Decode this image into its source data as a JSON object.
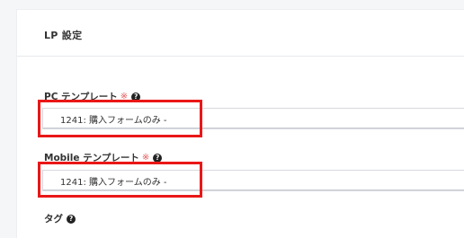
{
  "section": {
    "title": "LP 設定"
  },
  "fields": {
    "pc_template": {
      "label": "PC テンプレート",
      "required_mark": "※",
      "help_icon": "question-circle-icon",
      "value": "1241: 購入フォームのみ -"
    },
    "mobile_template": {
      "label": "Mobile テンプレート",
      "required_mark": "※",
      "help_icon": "question-circle-icon",
      "value": "1241: 購入フォームのみ -"
    },
    "tag": {
      "label": "タグ",
      "help_icon": "question-circle-icon"
    }
  },
  "colors": {
    "highlight": "#e91717",
    "required": "#e75a5a"
  }
}
